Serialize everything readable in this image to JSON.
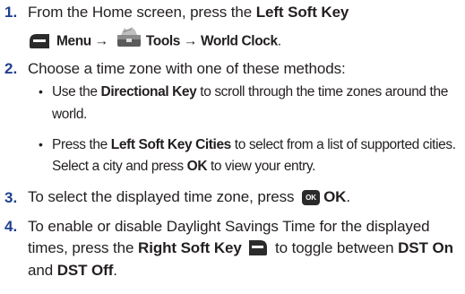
{
  "steps": [
    {
      "number": "1.",
      "line1": {
        "pre": "From the Home screen, press the ",
        "key": "Left Soft Key"
      },
      "line2": {
        "menu": "Menu",
        "arrow1": "→",
        "tools": "Tools",
        "arrow2": "→",
        "world_clock": "World Clock",
        "end": "."
      }
    },
    {
      "number": "2.",
      "text": "Choose a time zone with one of these methods:",
      "bullets": [
        {
          "bullet": "•",
          "l1_pre": "Use the ",
          "l1_key": "Directional Key",
          "l1_post": " to scroll through the time zones around the",
          "l2": "world."
        },
        {
          "bullet": "•",
          "l1_pre": "Press the ",
          "l1_key": "Left Soft Key Cities",
          "l1_post": " to select from a list of supported cities.",
          "l2_pre": "Select a city and press ",
          "l2_key": "OK",
          "l2_post": " to view your entry."
        }
      ]
    },
    {
      "number": "3.",
      "pre": "To select the displayed time zone, press ",
      "ok_icon_text": "OK",
      "key": "OK",
      "end": "."
    },
    {
      "number": "4.",
      "line1": "To enable or disable Daylight Savings Time for the displayed",
      "line2": {
        "pre": "times, press the ",
        "key": "Right Soft Key",
        "post": " to toggle between ",
        "dst_on": "DST On"
      },
      "line3": {
        "and": "and ",
        "dst_off": "DST Off",
        "end": "."
      }
    }
  ],
  "colors": {
    "step_number": "#1f3f8f",
    "text": "#231f20",
    "icon_dark": "#2b2b2b"
  },
  "icons": [
    "left-soft-key-icon",
    "tools-icon",
    "ok-key-icon",
    "right-soft-key-icon"
  ]
}
